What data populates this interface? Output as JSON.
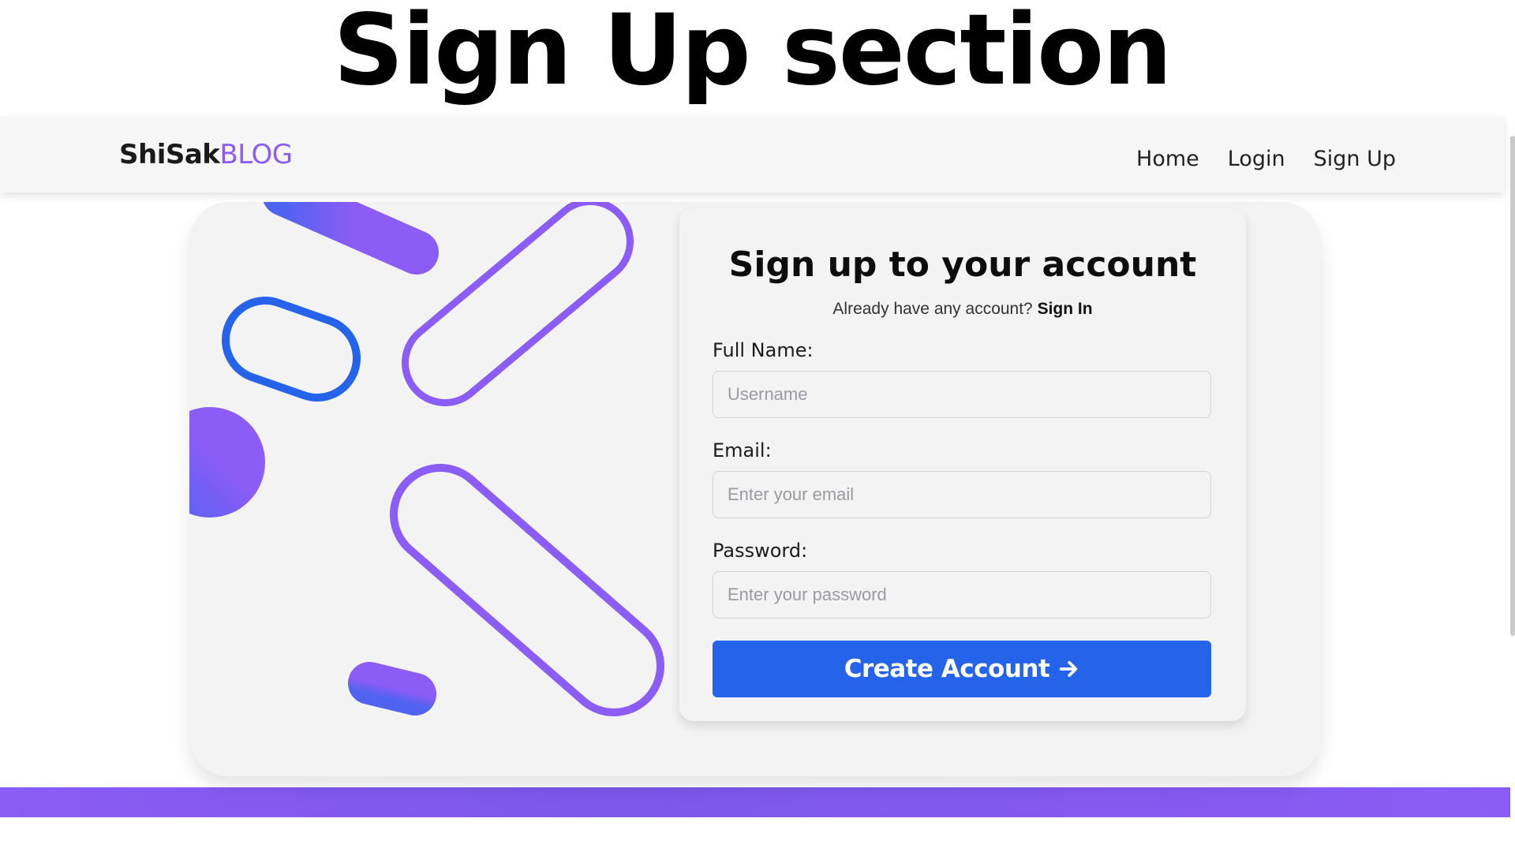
{
  "caption": "Sign Up section",
  "navbar": {
    "brand_main": "ShiSak",
    "brand_accent": "BLOG",
    "links": [
      "Home",
      "Login",
      "Sign Up"
    ]
  },
  "form": {
    "title": "Sign up to your account",
    "subtitle": "Already have any account?",
    "signin_link": "Sign In",
    "fields": [
      {
        "label": "Full Name:",
        "placeholder": "Username"
      },
      {
        "label": "Email:",
        "placeholder": "Enter your email"
      },
      {
        "label": "Password:",
        "placeholder": "Enter your password"
      }
    ],
    "submit_label": "Create Account",
    "submit_icon": "arrow-right-icon"
  },
  "colors": {
    "accent_purple": "#8b5cf6",
    "primary_blue": "#2563eb",
    "card_bg": "#f3f3f4"
  }
}
